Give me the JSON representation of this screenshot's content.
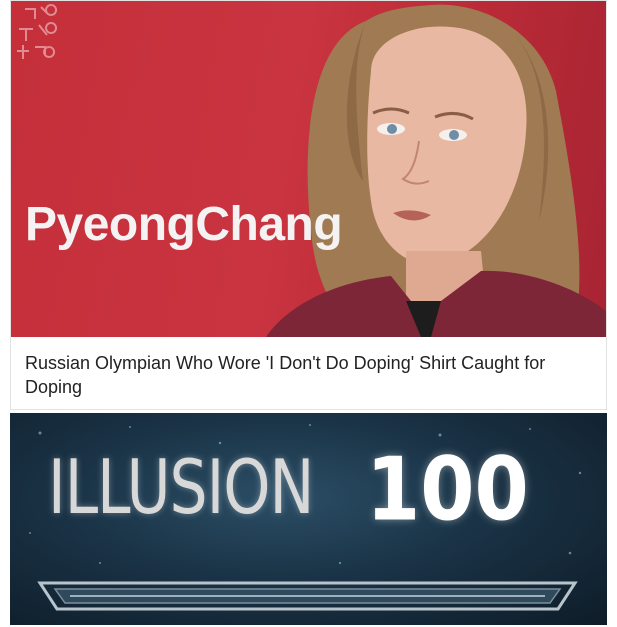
{
  "article": {
    "image_caption_brand": "PyeongChang",
    "headline": "Russian Olympian Who Wore 'I Don't Do Doping' Shirt Caught for Doping"
  },
  "game": {
    "skill_name": "ILLUSION",
    "skill_level": "100"
  },
  "colors": {
    "backdrop_red": "#c42f3a",
    "jacket_maroon": "#7d2638",
    "panel_blue": "#1a3346"
  }
}
